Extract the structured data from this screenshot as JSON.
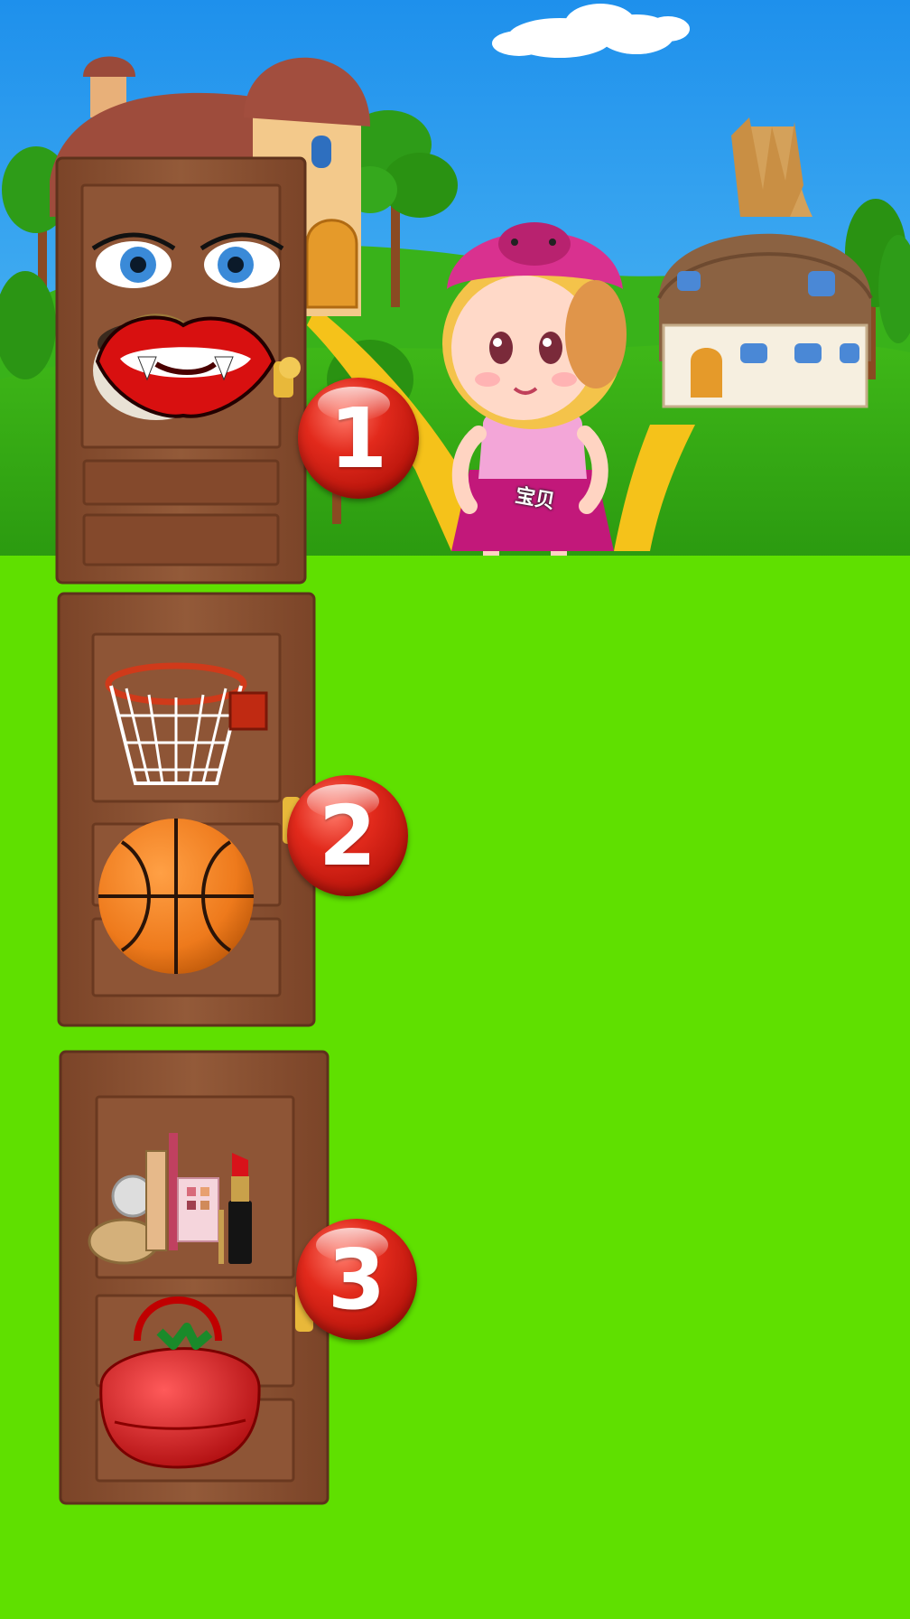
{
  "badges": [
    {
      "number": "1"
    },
    {
      "number": "2"
    },
    {
      "number": "3"
    }
  ],
  "character": {
    "shirt_label": "宝贝"
  },
  "doors": [
    {
      "items": [
        "face",
        "lips",
        "noodle-bowl"
      ]
    },
    {
      "items": [
        "basketball-hoop",
        "basketball"
      ]
    },
    {
      "items": [
        "makeup-set",
        "lipstick",
        "strawberry-handbag"
      ]
    }
  ],
  "colors": {
    "grass": "#5fe000",
    "sky": "#2aa3f0",
    "door": "#8a5134",
    "badge": "#d81e12"
  }
}
